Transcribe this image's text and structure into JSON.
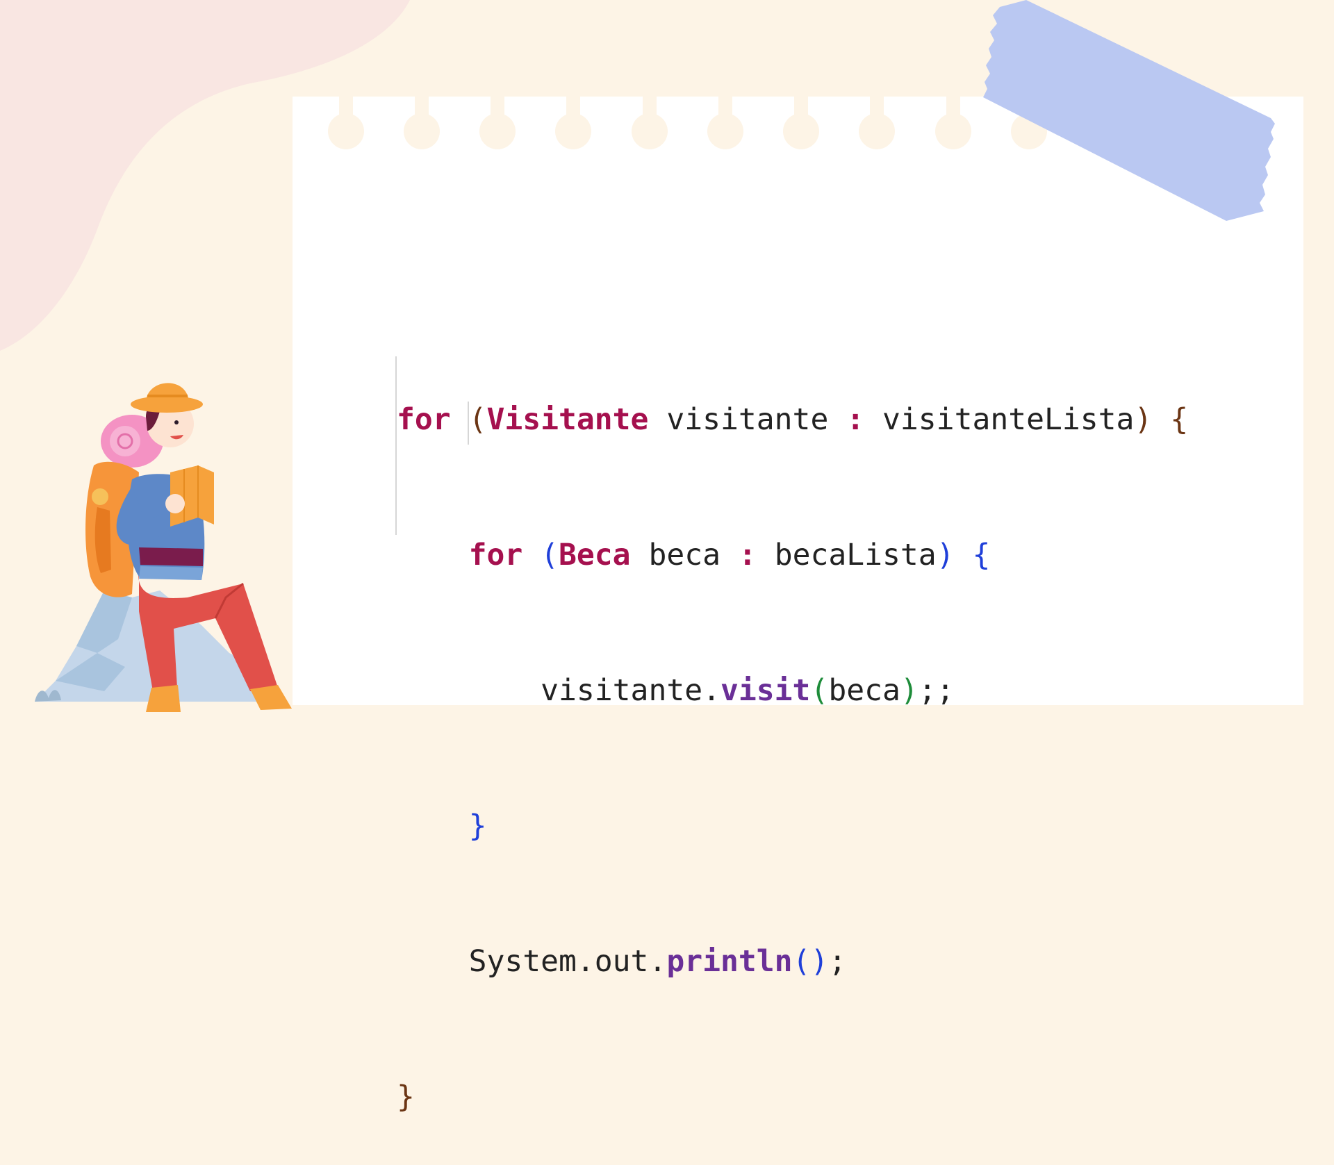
{
  "code": {
    "line1": {
      "kw_for": "for",
      "paren_open": "(",
      "type": "Visitante",
      "var": " visitante ",
      "colon": ":",
      "list": " visitanteLista",
      "paren_close": ")",
      "brace": "{"
    },
    "line2": {
      "kw_for": "for",
      "paren_open": "(",
      "type": "Beca",
      "var": " beca ",
      "colon": ":",
      "list": " becaLista",
      "paren_close": ")",
      "brace": "{"
    },
    "line3": {
      "obj": "visitante.",
      "method": "visit",
      "paren_open": "(",
      "arg": "beca",
      "paren_close": ")",
      "end": ";;"
    },
    "line4": {
      "brace": "}"
    },
    "line5": {
      "obj": "System.out.",
      "method": "println",
      "paren_open": "(",
      "paren_close": ")",
      "end": ";"
    },
    "line6": {
      "brace": "}"
    }
  },
  "colors": {
    "background": "#fdf4e6",
    "paper": "#ffffff",
    "tape": "#bac8f2",
    "blob": "#f9e6e2",
    "keyword": "#a5104e",
    "method": "#6a2f97"
  },
  "illustration": {
    "subject": "hiker-with-map",
    "icons": [
      "hiker-illustration",
      "tape-strip",
      "background-blob"
    ]
  }
}
